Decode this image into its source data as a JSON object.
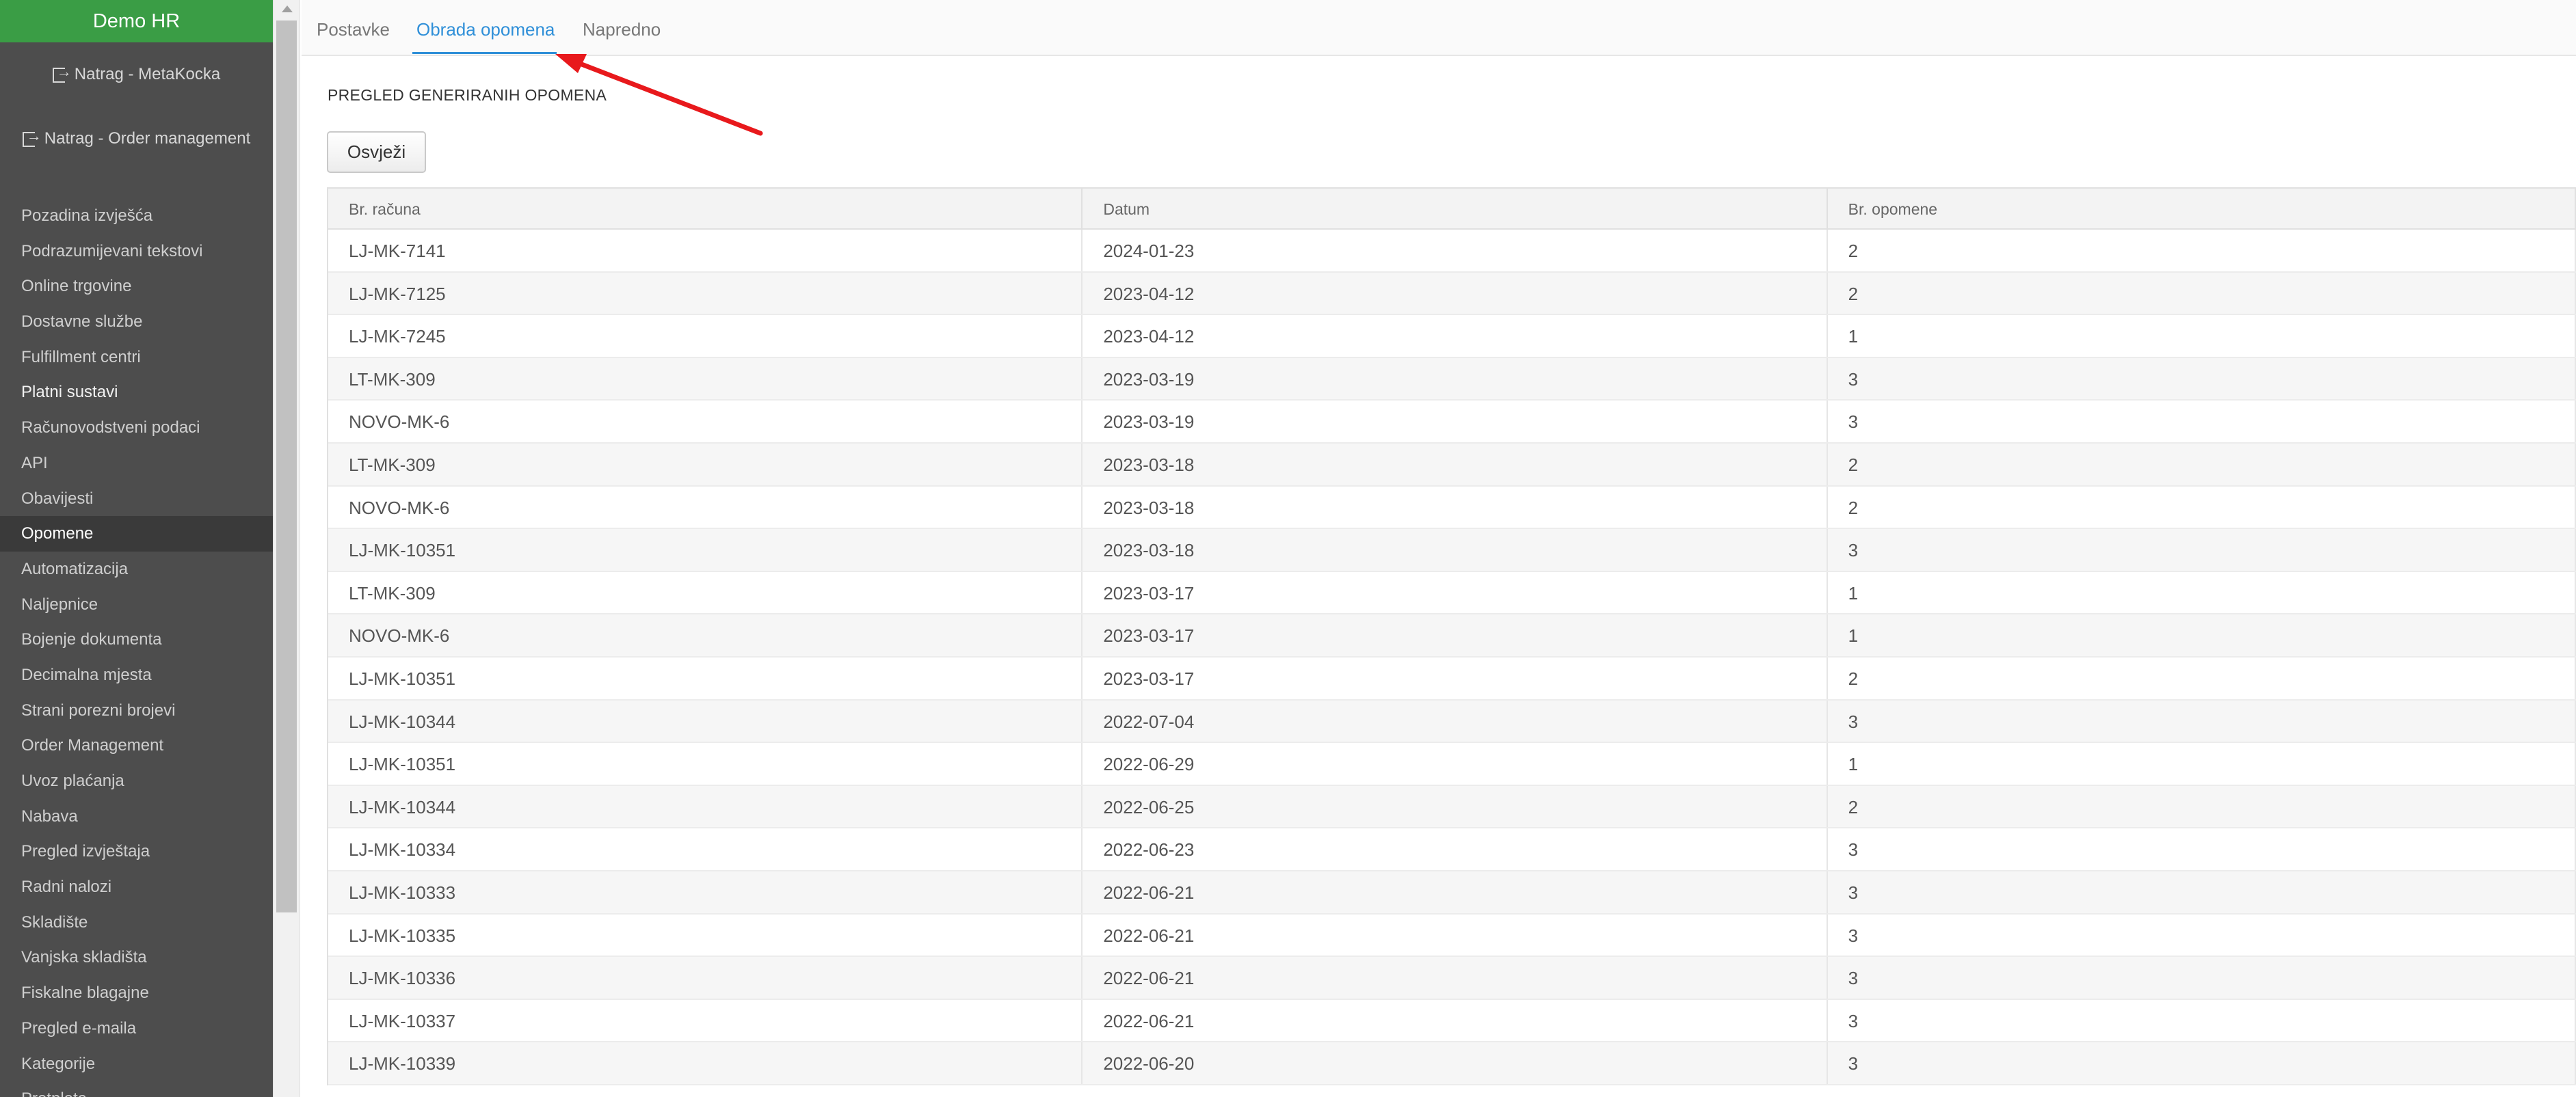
{
  "sidebar": {
    "brand": "Demo HR",
    "back_links": [
      "Natrag - MetaKocka",
      "Natrag - Order management"
    ],
    "items": [
      {
        "label": "Pozadina izvješća"
      },
      {
        "label": "Podrazumijevani tekstovi"
      },
      {
        "label": "Online trgovine"
      },
      {
        "label": "Dostavne službe"
      },
      {
        "label": "Fulfillment centri"
      },
      {
        "label": "Platni sustavi"
      },
      {
        "label": "Računovodstveni podaci"
      },
      {
        "label": "API"
      },
      {
        "label": "Obavijesti"
      },
      {
        "label": "Opomene",
        "active": true
      },
      {
        "label": "Automatizacija"
      },
      {
        "label": "Naljepnice"
      },
      {
        "label": "Bojenje dokumenta"
      },
      {
        "label": "Decimalna mjesta"
      },
      {
        "label": "Strani porezni brojevi"
      },
      {
        "label": "Order Management"
      },
      {
        "label": "Uvoz plaćanja"
      },
      {
        "label": "Nabava"
      },
      {
        "label": "Pregled izvještaja"
      },
      {
        "label": "Radni nalozi"
      },
      {
        "label": "Skladište"
      },
      {
        "label": "Vanjska skladišta"
      },
      {
        "label": "Fiskalne blagajne"
      },
      {
        "label": "Pregled e-maila"
      },
      {
        "label": "Kategorije"
      },
      {
        "label": "Pretplata"
      }
    ]
  },
  "tabs": [
    {
      "label": "Postavke"
    },
    {
      "label": "Obrada opomena",
      "active": true
    },
    {
      "label": "Napredno"
    }
  ],
  "section_title": "PREGLED GENERIRANIH OPOMENA",
  "refresh_button": "Osvježi",
  "table": {
    "columns": [
      "Br. računa",
      "Datum",
      "Br. opomene"
    ],
    "rows": [
      [
        "LJ-MK-7141",
        "2024-01-23",
        "2"
      ],
      [
        "LJ-MK-7125",
        "2023-04-12",
        "2"
      ],
      [
        "LJ-MK-7245",
        "2023-04-12",
        "1"
      ],
      [
        "LT-MK-309",
        "2023-03-19",
        "3"
      ],
      [
        "NOVO-MK-6",
        "2023-03-19",
        "3"
      ],
      [
        "LT-MK-309",
        "2023-03-18",
        "2"
      ],
      [
        "NOVO-MK-6",
        "2023-03-18",
        "2"
      ],
      [
        "LJ-MK-10351",
        "2023-03-18",
        "3"
      ],
      [
        "LT-MK-309",
        "2023-03-17",
        "1"
      ],
      [
        "NOVO-MK-6",
        "2023-03-17",
        "1"
      ],
      [
        "LJ-MK-10351",
        "2023-03-17",
        "2"
      ],
      [
        "LJ-MK-10344",
        "2022-07-04",
        "3"
      ],
      [
        "LJ-MK-10351",
        "2022-06-29",
        "1"
      ],
      [
        "LJ-MK-10344",
        "2022-06-25",
        "2"
      ],
      [
        "LJ-MK-10334",
        "2022-06-23",
        "3"
      ],
      [
        "LJ-MK-10333",
        "2022-06-21",
        "3"
      ],
      [
        "LJ-MK-10335",
        "2022-06-21",
        "3"
      ],
      [
        "LJ-MK-10336",
        "2022-06-21",
        "3"
      ],
      [
        "LJ-MK-10337",
        "2022-06-21",
        "3"
      ],
      [
        "LJ-MK-10339",
        "2022-06-20",
        "3"
      ]
    ]
  },
  "colors": {
    "brand": "#3a9d45",
    "sidebar": "#4d4d4d",
    "accent": "#2f8fd8",
    "annotation_arrow": "#e8191c"
  },
  "icons": {
    "back_link": "sign-out-icon"
  }
}
